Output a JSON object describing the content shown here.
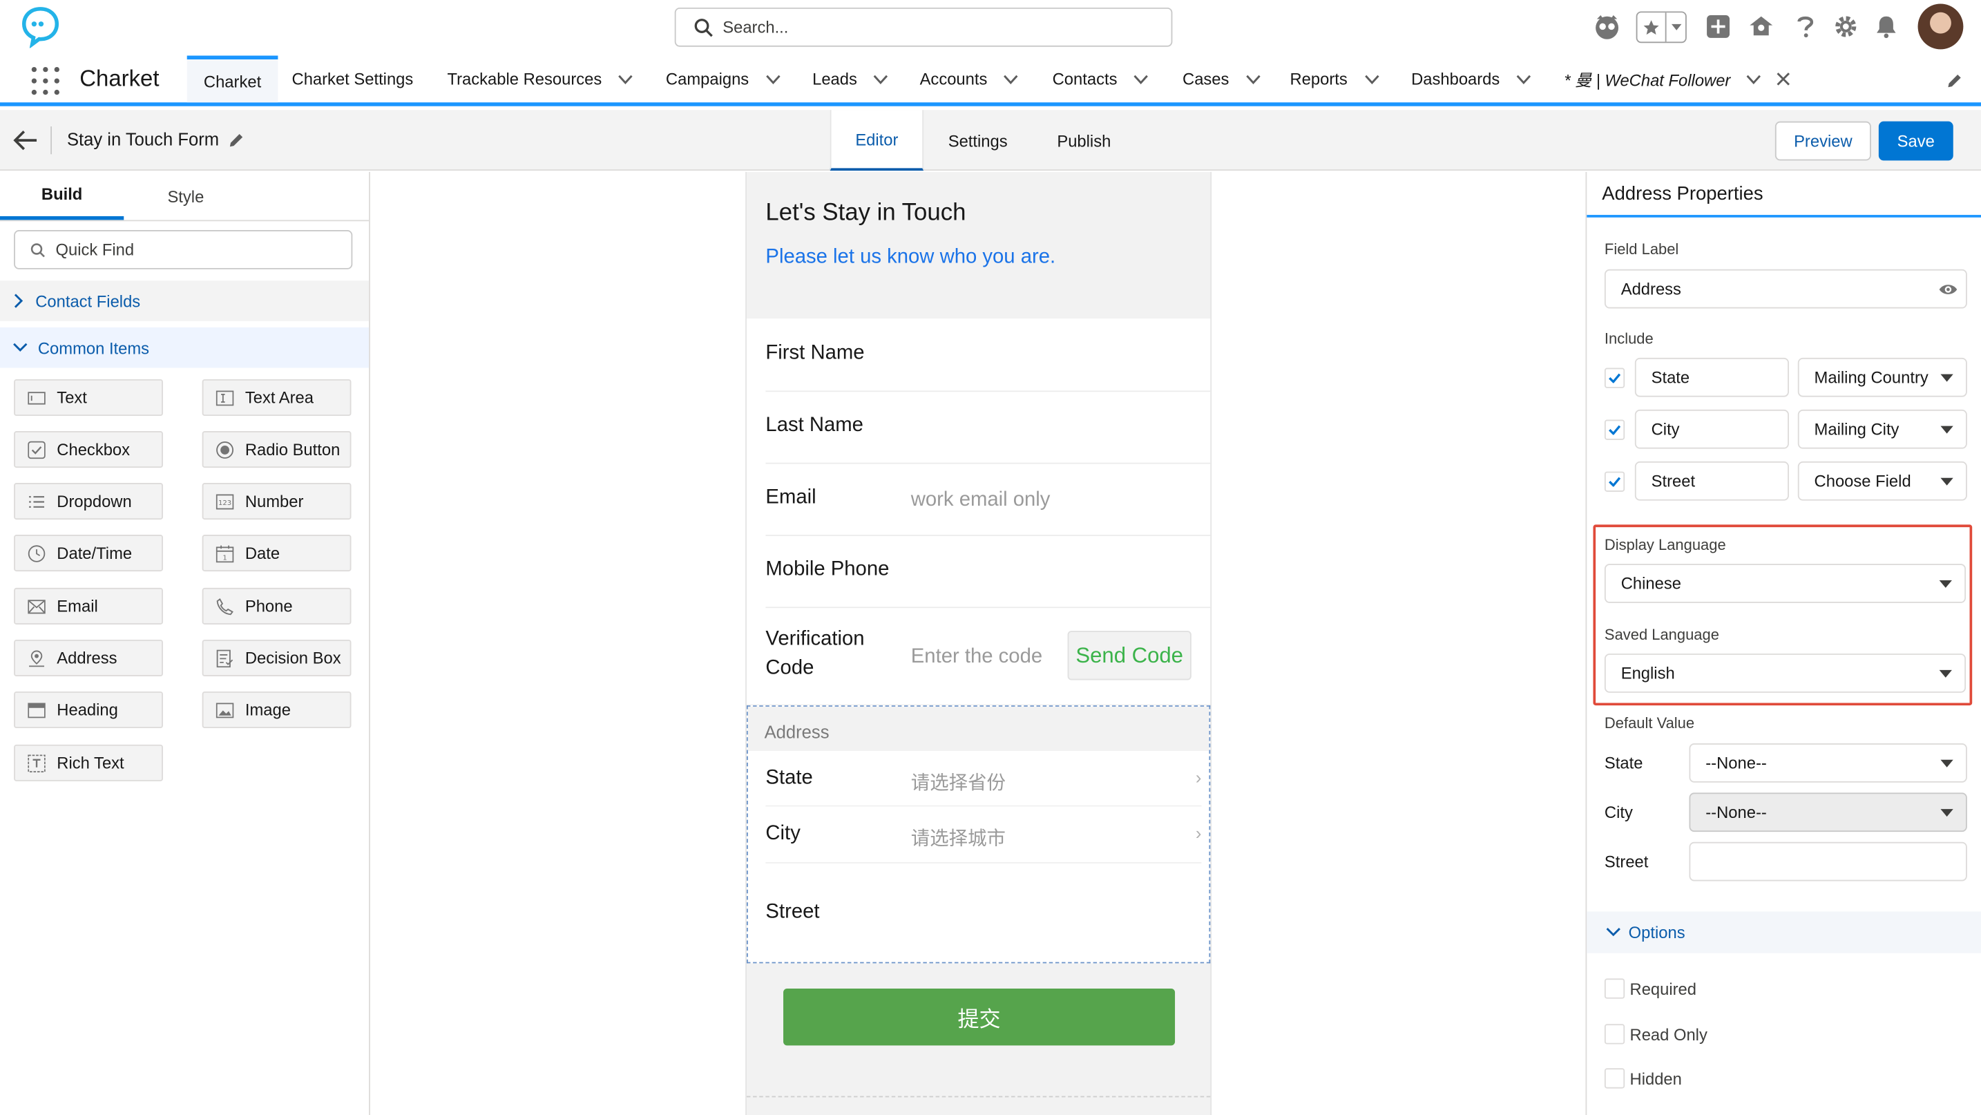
{
  "topbar": {
    "search_placeholder": "Search...",
    "icons": [
      "guidance-icon",
      "favorites-icon",
      "global-actions-icon",
      "setup-assistant-icon",
      "help-icon",
      "setup-gear-icon",
      "notifications-bell-icon",
      "user-avatar"
    ]
  },
  "nav": {
    "app_name": "Charket",
    "items": [
      {
        "label": "Charket",
        "active": true
      },
      {
        "label": "Charket Settings"
      },
      {
        "label": "Trackable Resources"
      },
      {
        "label": "Campaigns"
      },
      {
        "label": "Leads"
      },
      {
        "label": "Accounts"
      },
      {
        "label": "Contacts"
      },
      {
        "label": "Cases"
      },
      {
        "label": "Reports"
      },
      {
        "label": "Dashboards"
      }
    ],
    "open_tab_label": "* 曼 | WeChat Follower"
  },
  "builder": {
    "title": "Stay in Touch Form",
    "tabs": [
      "Editor",
      "Settings",
      "Publish"
    ],
    "active_tab": "Editor",
    "preview_label": "Preview",
    "save_label": "Save"
  },
  "left": {
    "tabs": [
      "Build",
      "Style"
    ],
    "quick_find_placeholder": "Quick Find",
    "section_contact": "Contact Fields",
    "section_common": "Common Items",
    "items": [
      "Text",
      "Text Area",
      "Checkbox",
      "Radio Button",
      "Dropdown",
      "Number",
      "Date/Time",
      "Date",
      "Email",
      "Phone",
      "Address",
      "Decision Box",
      "Heading",
      "Image",
      "Rich Text"
    ]
  },
  "form": {
    "title": "Let's Stay in Touch",
    "subtitle": "Please let us know who you are.",
    "first_name": "First Name",
    "last_name": "Last Name",
    "email": "Email",
    "email_placeholder": "work email only",
    "mobile": "Mobile Phone",
    "verification_line1": "Verification",
    "verification_line2": "Code",
    "code_placeholder": "Enter the code",
    "send_code": "Send Code",
    "address_header": "Address",
    "state": "State",
    "state_placeholder": "请选择省份",
    "city": "City",
    "city_placeholder": "请选择城市",
    "street": "Street",
    "submit": "提交",
    "accent_color": "#56a44c"
  },
  "props": {
    "title": "Address Properties",
    "field_label_caption": "Field Label",
    "field_label_value": "Address",
    "include_caption": "Include",
    "include_rows": [
      {
        "checked": true,
        "name": "State",
        "map": "Mailing Country"
      },
      {
        "checked": true,
        "name": "City",
        "map": "Mailing City"
      },
      {
        "checked": true,
        "name": "Street",
        "map": "Choose Field"
      }
    ],
    "display_language_caption": "Display Language",
    "display_language": "Chinese",
    "saved_language_caption": "Saved Language",
    "saved_language": "English",
    "default_value_caption": "Default Value",
    "default_state_label": "State",
    "default_state": "--None--",
    "default_city_label": "City",
    "default_city": "--None--",
    "default_street_label": "Street",
    "options_label": "Options",
    "options": [
      "Required",
      "Read Only",
      "Hidden"
    ],
    "highlight_color": "#e04a3a"
  }
}
